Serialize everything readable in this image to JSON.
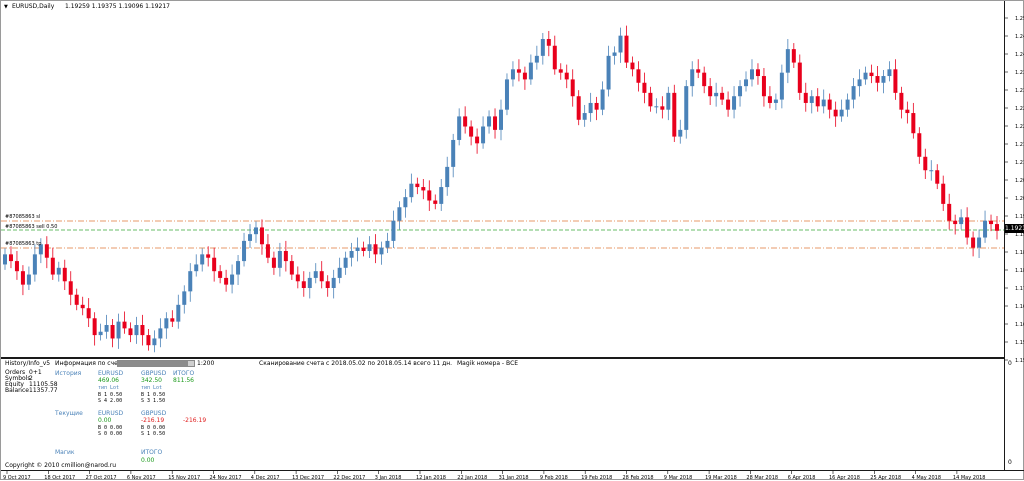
{
  "header": {
    "arrow": "▼",
    "symbol": "EURUSD,Daily",
    "ohlc": "1.19259 1.19375 1.19096 1.19217"
  },
  "price_axis": [
    "1.25525",
    "1.24985",
    "1.24445",
    "1.23905",
    "1.23380",
    "1.22840",
    "1.22300",
    "1.21760",
    "1.21220",
    "1.20695",
    "1.20155",
    "1.19615",
    "1.19075",
    "1.18535",
    "1.18010",
    "1.17470",
    "1.16930",
    "1.16390",
    "1.15850",
    "1.15325"
  ],
  "current_price": "1.19217",
  "dates": [
    "9 Oct 2017",
    "18 Oct 2017",
    "27 Oct 2017",
    "6 Nov 2017",
    "15 Nov 2017",
    "24 Nov 2017",
    "4 Dec 2017",
    "13 Dec 2017",
    "22 Dec 2017",
    "3 Jan 2018",
    "12 Jan 2018",
    "22 Jan 2018",
    "31 Jan 2018",
    "9 Feb 2018",
    "19 Feb 2018",
    "28 Feb 2018",
    "9 Mar 2018",
    "19 Mar 2018",
    "28 Mar 2018",
    "6 Apr 2018",
    "16 Apr 2018",
    "25 Apr 2018",
    "4 May 2018",
    "14 May 2018"
  ],
  "order_lines": {
    "sl": "#87085863 sl",
    "sell": "#87085863 sell 0.50",
    "tp": "#87085863 tp"
  },
  "indicator_panel": {
    "name": "History/Info_v5",
    "account_info": "Информация по счету",
    "progress_value": "1:200",
    "progress_fraction": 0.92,
    "scan_text": "Сканирование счета с 2018.05.02 по 2018.05.14 всего 11 дн.",
    "magic_text": "Magik номера - ВСЕ",
    "axis_top": "0",
    "axis_bottom": "0",
    "orders_label": "Orders",
    "orders_value": "0+1",
    "symbols_label": "Symbols",
    "symbols_value": "2",
    "equity_label": "Equity",
    "equity_value": "11105.58",
    "balance_label": "Balance",
    "balance_value": "11357.77",
    "history_label": "История",
    "current_label": "Текущие",
    "magic_label": "Магик",
    "col_eurusd": "EURUSD",
    "col_gbpusd": "GBPUSD",
    "col_total": "ИТОГО",
    "hist_eur_value": "469.06",
    "hist_gbp_value": "342.50",
    "hist_total": "811.56",
    "type_lot_header": "тип  Lot",
    "hist_eur_b": "B 1   0.50",
    "hist_eur_s": "S 4   2.00",
    "hist_gbp_b": "B 1   0.50",
    "hist_gbp_s": "S 3   1.50",
    "cur_eur_value": "0.00",
    "cur_gbp_value": "-216.19",
    "cur_total": "-216.19",
    "cur_eur_b": "B 0   0.00",
    "cur_eur_s": "S 0   0.00",
    "cur_gbp_b": "B 0   0.00",
    "cur_gbp_s": "S 1   0.50",
    "magic_total": "ИТОГО",
    "magic_value": "0.00",
    "copyright": "Copyright © 2010 cmillion@narod.ru"
  },
  "colors": {
    "bull": "#4a82b8",
    "bear": "#e8001c",
    "sl_tp_line": "#e07a3a",
    "entry_line": "#3aa83a"
  }
}
